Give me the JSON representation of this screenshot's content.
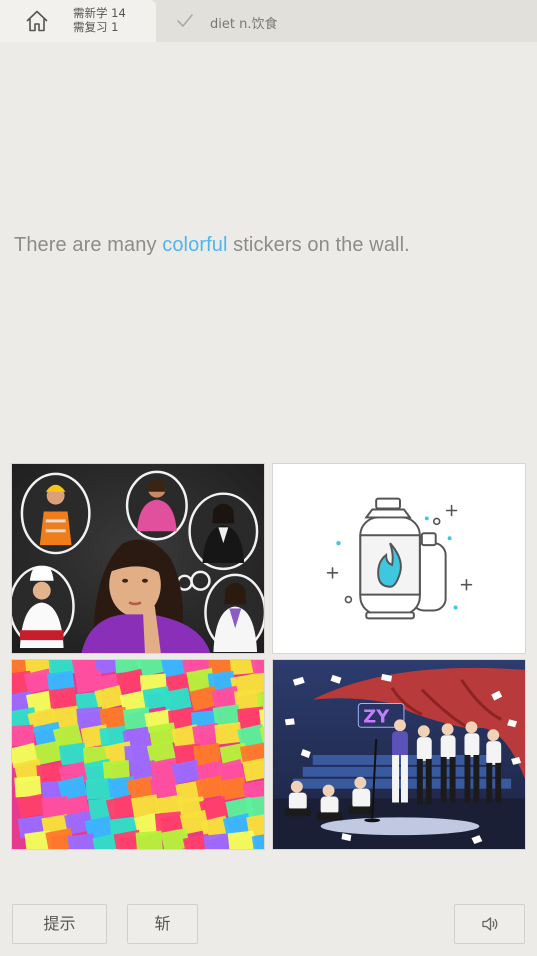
{
  "header": {
    "home_icon": "home-icon",
    "new_count": "需新学 14",
    "review_count": "需复习 1",
    "check_icon": "check-icon",
    "word": "diet n.饮食"
  },
  "sentence": {
    "before": "There are many ",
    "highlight": "colorful",
    "after": " stickers on the wall.",
    "highlight_color": "#4fb6ee"
  },
  "options": [
    {
      "id": "option-1",
      "depicts": "thinking-woman-with-professions"
    },
    {
      "id": "option-2",
      "depicts": "gas-cylinder-illustration"
    },
    {
      "id": "option-3",
      "depicts": "colorful-sticky-notes-wall"
    },
    {
      "id": "option-4",
      "depicts": "dance-group-on-stage"
    }
  ],
  "footer": {
    "hint_label": "提示",
    "kill_label": "斩",
    "audio_icon": "speaker-icon"
  }
}
